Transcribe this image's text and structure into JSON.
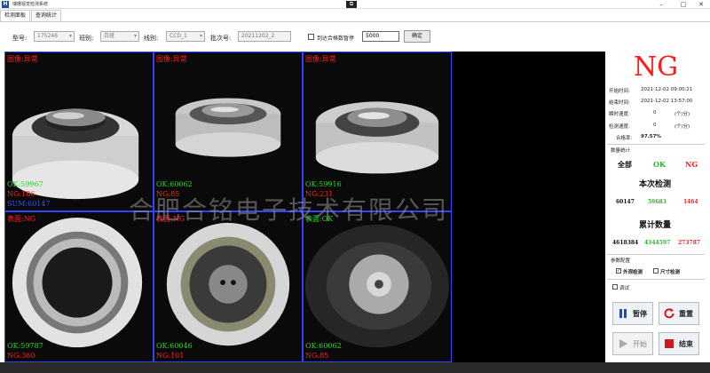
{
  "window": {
    "title": "瑞珊视觉检测系统",
    "app_icon": "H",
    "restore_glyph": "⧉",
    "minimize": "–",
    "maximize": "□",
    "close": "✕"
  },
  "tabs": [
    {
      "label": "检测面板",
      "active": true
    },
    {
      "label": "查询统计",
      "active": false
    }
  ],
  "toolbar": {
    "model_label": "型号:",
    "model_value": "175246",
    "shift_label": "班别:",
    "shift_value": "白班",
    "line_label": "线别:",
    "line_value": "CCD_1",
    "batch_label": "批次号:",
    "batch_value": "20211202_2",
    "stop_label": "到达合格数暂停",
    "stop_value": "5000",
    "confirm_label": "确定"
  },
  "cameras": [
    {
      "header": "图像:异常",
      "ok": "OK:59967",
      "ng": "NG:186",
      "sum": "SUM:60147"
    },
    {
      "header": "图像:异常",
      "ok": "OK:60062",
      "ng": "NG:85",
      "sum": ""
    },
    {
      "header": "图像:异常",
      "ok": "OK:59916",
      "ng": "NG:231",
      "sum": ""
    },
    {
      "header": "表面:NG",
      "ok": "OK:59787",
      "ng": "NG:360",
      "sum": ""
    },
    {
      "header": "表面:NG",
      "ok": "OK:60046",
      "ng": "NG:101",
      "sum": ""
    },
    {
      "header": "表面:OK",
      "ok": "OK:60062",
      "ng": "NG:85",
      "sum": ""
    }
  ],
  "watermark": "合肥合铭电子技术有限公司",
  "status": {
    "result": "NG",
    "start_label": "开始时间:",
    "start_value": "2021-12-02 09:00:21",
    "end_label": "结束时间:",
    "end_value": "2021-12-02 13:57:00",
    "instant_label": "瞬时速度:",
    "instant_value": "0",
    "instant_unit": "(个/分)",
    "detect_label": "检测速度:",
    "detect_value": "0",
    "detect_unit": "(个/分)",
    "rate_label": "合格率:",
    "rate_value": "97.57%"
  },
  "counts": {
    "section_title": "数量统计",
    "col_all": "全部",
    "col_ok": "OK",
    "col_ng": "NG",
    "current_title": "本次检测",
    "current_all": "60147",
    "current_ok": "59683",
    "current_ng": "1464",
    "total_title": "累计数量",
    "total_all": "4618384",
    "total_ok": "4344597",
    "total_ng": "273787"
  },
  "params": {
    "section_title": "参数配置",
    "appearance_label": "外观检测",
    "appearance_checked": true,
    "size_label": "尺寸检测",
    "size_checked": false,
    "debug_label": "调试",
    "debug_checked": false
  },
  "controls": {
    "pause_label": "暂停",
    "reset_label": "重置",
    "start_label": "开始",
    "end_label": "结束"
  },
  "colors": {
    "ng_red": "#ff1a1a",
    "ok_green": "#22dd22",
    "cell_border": "#3344ff"
  }
}
